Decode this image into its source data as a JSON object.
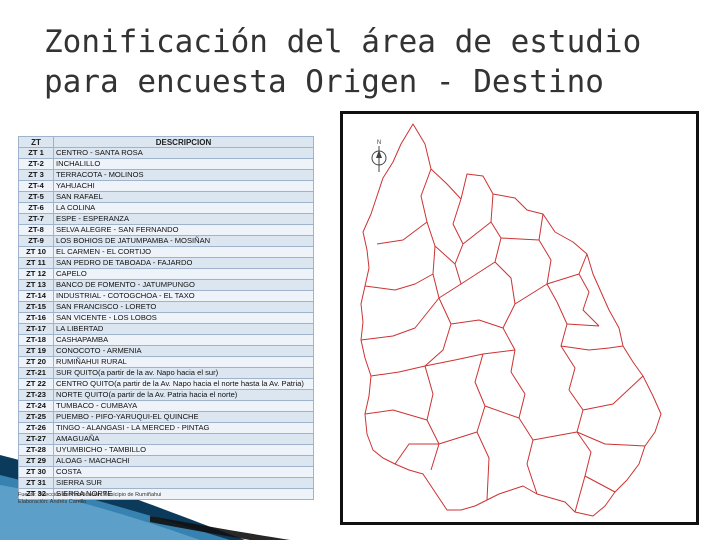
{
  "slide": {
    "title_line1": "Zonificación del área de estudio",
    "title_line2": "para encuesta Origen - Destino"
  },
  "table": {
    "headers": [
      "ZT",
      "DESCRIPCION"
    ],
    "rows": [
      [
        "ZT 1",
        "CENTRO - SANTA ROSA"
      ],
      [
        "ZT-2",
        "INCHALILLO"
      ],
      [
        "ZT 3",
        "TERRACOTA - MOLINOS"
      ],
      [
        "ZT-4",
        "YAHUACHI"
      ],
      [
        "ZT-5",
        "SAN RAFAEL"
      ],
      [
        "ZT-6",
        "LA COLINA"
      ],
      [
        "ZT-7",
        "ESPE - ESPERANZA"
      ],
      [
        "ZT-8",
        "SELVA ALEGRE - SAN FERNANDO"
      ],
      [
        "ZT-9",
        "LOS BOHIOS DE JATUMPAMBA - MOSIÑAN"
      ],
      [
        "ZT 10",
        "EL CARMEN - EL CORTIJO"
      ],
      [
        "ZT 11",
        "SAN PEDRO DE TABOADA - FAJARDO"
      ],
      [
        "ZT 12",
        "CAPELO"
      ],
      [
        "ZT 13",
        "BANCO DE FOMENTO - JATUMPUNGO"
      ],
      [
        "ZT-14",
        "INDUSTRIAL - COTOGCHOA - EL TAXO"
      ],
      [
        "ZT-15",
        "SAN FRANCISCO - LORETO"
      ],
      [
        "ZT-16",
        "SAN VICENTE - LOS LOBOS"
      ],
      [
        "ZT-17",
        "LA LIBERTAD"
      ],
      [
        "ZT-18",
        "CASHAPAMBA"
      ],
      [
        "ZT 19",
        "CONOCOTO - ARMENIA"
      ],
      [
        "ZT 20",
        "RUMIÑAHUI RURAL"
      ],
      [
        "ZT-21",
        "SUR QUITO(a partir de la av. Napo hacia el sur)"
      ],
      [
        "ZT 22",
        "CENTRO QUITO(a partir de la Av. Napo hacia el norte hasta la Av. Patria)"
      ],
      [
        "ZT-23",
        "NORTE QUITO(a partir de la Av. Patria hacia el norte)"
      ],
      [
        "ZT-24",
        "TUMBACO - CUMBAYA"
      ],
      [
        "ZT-25",
        "PUEMBO - PIFO-YARUQUI-EL QUINCHE"
      ],
      [
        "ZT-26",
        "TINGO - ALANGASI - LA MERCED - PINTAG"
      ],
      [
        "ZT-27",
        "AMAGUAÑA"
      ],
      [
        "ZT-28",
        "UYUMBICHO - TAMBILLO"
      ],
      [
        "ZT 29",
        "ALOAG - MACHACHI"
      ],
      [
        "ZT 30",
        "COSTA"
      ],
      [
        "ZT 31",
        "SIERRA SUR"
      ],
      [
        "ZT 32",
        "SIERRA NORTE"
      ]
    ],
    "source_line1": "Fuente: Dirección de Planificación Municipio de Rumiñahui",
    "source_line2": "Elaboración: Andrés Carrillo"
  },
  "map": {
    "north_symbol": "N",
    "border_color": "#cc3333",
    "frame_color": "#111111"
  },
  "colors": {
    "title": "#333333",
    "row_a": "#dce6f1",
    "row_b": "#eef3f9",
    "swoosh_dark": "#0b3a5a",
    "swoosh_light": "#3f8fc0"
  }
}
